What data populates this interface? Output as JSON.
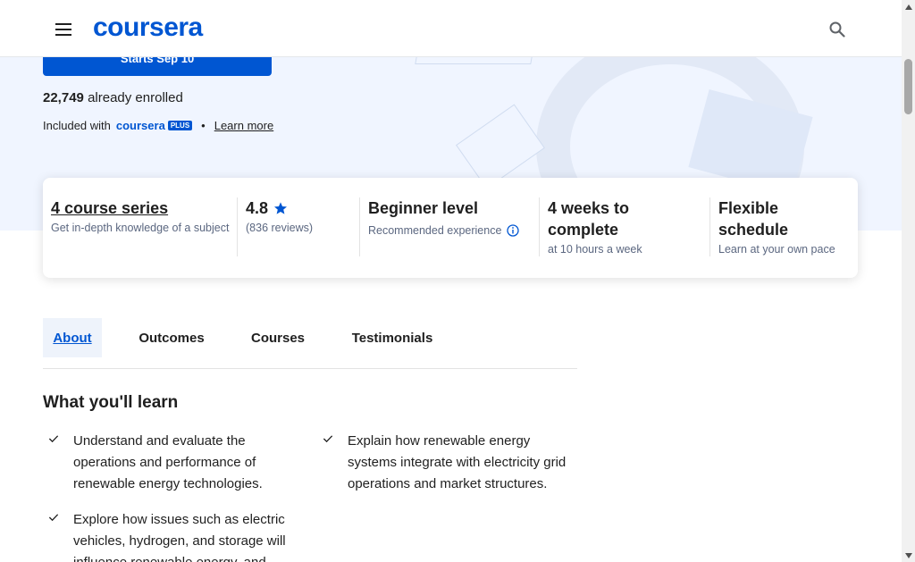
{
  "header": {
    "logo": "coursera",
    "menu_icon": "menu-icon",
    "search_icon": "search-icon"
  },
  "hero": {
    "enroll_label": "Starts Sep 10",
    "enrolled_count": "22,749",
    "enrolled_text": "already enrolled",
    "included_with": "Included with",
    "plus_wordmark": "coursera",
    "plus_badge": "PLUS",
    "learn_more": "Learn more"
  },
  "stats": [
    {
      "title": "4 course series",
      "sub": "Get in-depth knowledge of a subject"
    },
    {
      "title": "4.8",
      "sub": "(836 reviews)",
      "icon": "star-icon"
    },
    {
      "title": "Beginner level",
      "sub": "Recommended experience",
      "icon": "info-icon"
    },
    {
      "title": "4 weeks to complete",
      "sub": "at 10 hours a week"
    },
    {
      "title": "Flexible schedule",
      "sub": "Learn at your own pace"
    }
  ],
  "tabs": [
    "About",
    "Outcomes",
    "Courses",
    "Testimonials"
  ],
  "learn": {
    "title": "What you'll learn",
    "items": [
      "Understand and evaluate the operations and performance of renewable energy technologies.",
      "Explain how renewable energy systems integrate with electricity grid operations and market structures.",
      "Explore how issues such as electric vehicles, hydrogen, and storage will influence renewable energy, and"
    ]
  },
  "colors": {
    "brand": "#0056d2",
    "hero_bg": "#f0f5ff"
  }
}
